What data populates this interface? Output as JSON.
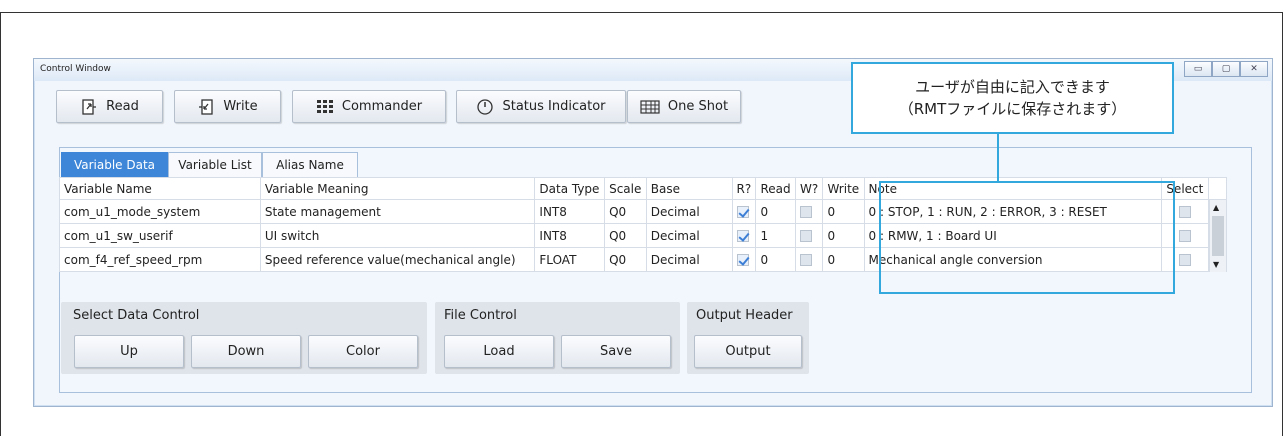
{
  "window": {
    "title": "Control Window",
    "controls": [
      "minimize-icon",
      "maximize-icon",
      "close-icon"
    ]
  },
  "toolbar": {
    "read_label": "Read",
    "write_label": "Write",
    "commander_label": "Commander",
    "status_indicator_label": "Status Indicator",
    "one_shot_label": "One Shot"
  },
  "callout": {
    "line1": "ユーザが自由に記入できます",
    "line2": "（RMTファイルに保存されます）"
  },
  "tabs": [
    {
      "label": "Variable Data",
      "active": true
    },
    {
      "label": "Variable List",
      "active": false
    },
    {
      "label": "Alias Name",
      "active": false
    }
  ],
  "table": {
    "headers": {
      "variable_name": "Variable Name",
      "variable_meaning": "Variable Meaning",
      "data_type": "Data Type",
      "scale": "Scale",
      "base": "Base",
      "r": "R?",
      "read": "Read",
      "w": "W?",
      "write": "Write",
      "note": "Note",
      "select": "Select"
    },
    "rows": [
      {
        "name": "com_u1_mode_system",
        "meaning": "State management",
        "type": "INT8",
        "scale": "Q0",
        "base": "Decimal",
        "r": true,
        "read": "0",
        "w": false,
        "write": "0",
        "note": "0 : STOP, 1 : RUN, 2 : ERROR, 3 : RESET",
        "select": false
      },
      {
        "name": "com_u1_sw_userif",
        "meaning": "UI switch",
        "type": "INT8",
        "scale": "Q0",
        "base": "Decimal",
        "r": true,
        "read": "1",
        "w": false,
        "write": "0",
        "note": "0 : RMW, 1 : Board UI",
        "select": false
      },
      {
        "name": "com_f4_ref_speed_rpm",
        "meaning": "Speed reference value(mechanical angle)",
        "type": "FLOAT",
        "scale": "Q0",
        "base": "Decimal",
        "r": true,
        "read": "0",
        "w": false,
        "write": "0",
        "note": "Mechanical angle conversion",
        "select": false
      }
    ]
  },
  "select_data_control": {
    "title": "Select Data Control",
    "up_label": "Up",
    "down_label": "Down",
    "color_label": "Color"
  },
  "file_control": {
    "title": "File Control",
    "load_label": "Load",
    "save_label": "Save"
  },
  "output_header": {
    "title": "Output Header",
    "output_label": "Output"
  },
  "colors": {
    "active_tab": "#3d86d8",
    "callout_border": "#33a8dd",
    "checkbox_check": "#3d7fd6"
  }
}
